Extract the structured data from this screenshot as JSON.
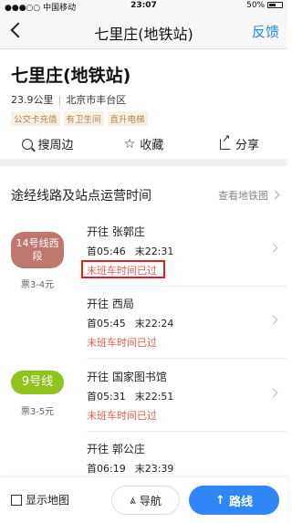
{
  "status": {
    "carrier": "●●●○○ 中国移动",
    "time": "23:07",
    "battery": "50%"
  },
  "nav": {
    "title": "七里庄(地铁站)",
    "feedback": "反馈"
  },
  "station": {
    "name": "七里庄(地铁站)",
    "distance": "23.9公里",
    "address": "北京市丰台区",
    "tags": [
      "公交卡充值",
      "有卫生间",
      "直升电梯"
    ]
  },
  "actions": {
    "nearby": "搜周边",
    "favorite": "收藏",
    "share": "分享"
  },
  "section": {
    "title": "途经线路及站点运营时间",
    "map_link": "查看地铁图"
  },
  "lines": [
    {
      "name": "14号线西段",
      "color": "#c07770",
      "price": "票3-4元",
      "directions": [
        {
          "to": "开往 张郭庄",
          "first": "首05:46",
          "last": "末22:31",
          "status": "末班车时间已过"
        },
        {
          "to": "开往 西局",
          "first": "首05:45",
          "last": "末22:24",
          "status": "末班车时间已过"
        }
      ]
    },
    {
      "name": "9号线",
      "color": "#8fc31f",
      "price": "票3-5元",
      "directions": [
        {
          "to": "开往 国家图书馆",
          "first": "首05:31",
          "last": "末22:51",
          "status": "末班车时间已过"
        },
        {
          "to": "开往 郭公庄",
          "first": "首06:19",
          "last": "末23:39",
          "status": ""
        }
      ]
    }
  ],
  "bottom": {
    "map": "显示地图",
    "navigate": "导航",
    "route": "路线"
  }
}
